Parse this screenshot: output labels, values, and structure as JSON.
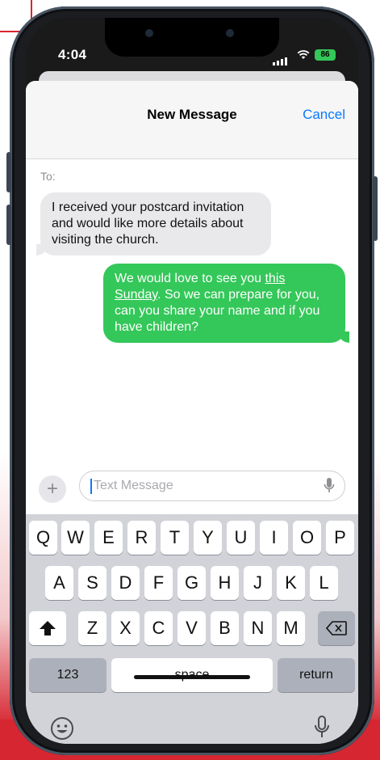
{
  "status": {
    "time": "4:04",
    "battery": "86"
  },
  "sheet": {
    "title": "New Message",
    "cancel": "Cancel",
    "to_label": "To:"
  },
  "messages": [
    {
      "from": "contact",
      "text": "I received your postcard invitation and would like more details about visiting the church."
    },
    {
      "from": "me",
      "text_before": "We would love to see you ",
      "link": "this Sunday",
      "text_after": ". So we can prepare for you, can you share your name and if you have children?"
    }
  ],
  "composer": {
    "placeholder": "Text Message",
    "plus": "+"
  },
  "keyboard": {
    "row1": [
      "Q",
      "W",
      "E",
      "R",
      "T",
      "Y",
      "U",
      "I",
      "O",
      "P"
    ],
    "row2": [
      "A",
      "S",
      "D",
      "F",
      "G",
      "H",
      "J",
      "K",
      "L"
    ],
    "row3": [
      "Z",
      "X",
      "C",
      "V",
      "B",
      "N",
      "M"
    ],
    "numbers": "123",
    "space": "space",
    "return": "return"
  },
  "colors": {
    "sent_bubble": "#34c759",
    "received_bubble": "#e9e9eb",
    "accent": "#0a7aff",
    "brand_red": "#d62631"
  },
  "icons": [
    "shift-icon",
    "backspace-icon",
    "emoji-icon",
    "microphone-icon",
    "plus-icon",
    "wifi-icon",
    "signal-icon",
    "battery-icon"
  ]
}
